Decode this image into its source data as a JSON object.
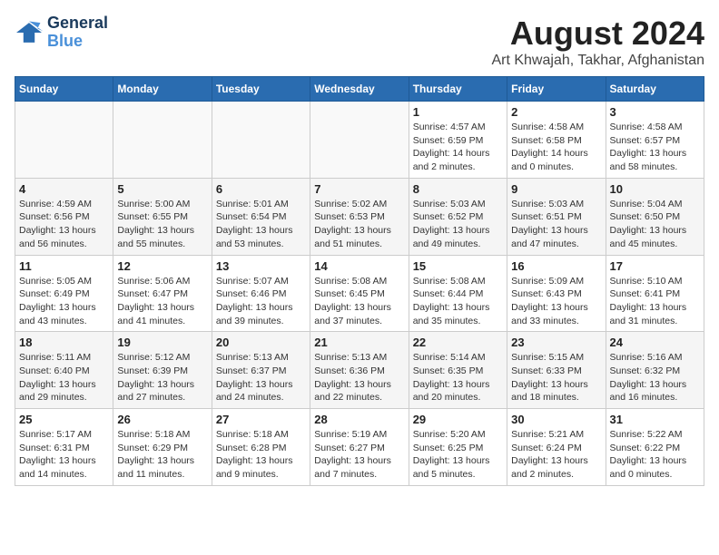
{
  "logo": {
    "line1": "General",
    "line2": "Blue"
  },
  "title": "August 2024",
  "subtitle": "Art Khwajah, Takhar, Afghanistan",
  "headers": [
    "Sunday",
    "Monday",
    "Tuesday",
    "Wednesday",
    "Thursday",
    "Friday",
    "Saturday"
  ],
  "weeks": [
    [
      {
        "day": "",
        "detail": ""
      },
      {
        "day": "",
        "detail": ""
      },
      {
        "day": "",
        "detail": ""
      },
      {
        "day": "",
        "detail": ""
      },
      {
        "day": "1",
        "detail": "Sunrise: 4:57 AM\nSunset: 6:59 PM\nDaylight: 14 hours\nand 2 minutes."
      },
      {
        "day": "2",
        "detail": "Sunrise: 4:58 AM\nSunset: 6:58 PM\nDaylight: 14 hours\nand 0 minutes."
      },
      {
        "day": "3",
        "detail": "Sunrise: 4:58 AM\nSunset: 6:57 PM\nDaylight: 13 hours\nand 58 minutes."
      }
    ],
    [
      {
        "day": "4",
        "detail": "Sunrise: 4:59 AM\nSunset: 6:56 PM\nDaylight: 13 hours\nand 56 minutes."
      },
      {
        "day": "5",
        "detail": "Sunrise: 5:00 AM\nSunset: 6:55 PM\nDaylight: 13 hours\nand 55 minutes."
      },
      {
        "day": "6",
        "detail": "Sunrise: 5:01 AM\nSunset: 6:54 PM\nDaylight: 13 hours\nand 53 minutes."
      },
      {
        "day": "7",
        "detail": "Sunrise: 5:02 AM\nSunset: 6:53 PM\nDaylight: 13 hours\nand 51 minutes."
      },
      {
        "day": "8",
        "detail": "Sunrise: 5:03 AM\nSunset: 6:52 PM\nDaylight: 13 hours\nand 49 minutes."
      },
      {
        "day": "9",
        "detail": "Sunrise: 5:03 AM\nSunset: 6:51 PM\nDaylight: 13 hours\nand 47 minutes."
      },
      {
        "day": "10",
        "detail": "Sunrise: 5:04 AM\nSunset: 6:50 PM\nDaylight: 13 hours\nand 45 minutes."
      }
    ],
    [
      {
        "day": "11",
        "detail": "Sunrise: 5:05 AM\nSunset: 6:49 PM\nDaylight: 13 hours\nand 43 minutes."
      },
      {
        "day": "12",
        "detail": "Sunrise: 5:06 AM\nSunset: 6:47 PM\nDaylight: 13 hours\nand 41 minutes."
      },
      {
        "day": "13",
        "detail": "Sunrise: 5:07 AM\nSunset: 6:46 PM\nDaylight: 13 hours\nand 39 minutes."
      },
      {
        "day": "14",
        "detail": "Sunrise: 5:08 AM\nSunset: 6:45 PM\nDaylight: 13 hours\nand 37 minutes."
      },
      {
        "day": "15",
        "detail": "Sunrise: 5:08 AM\nSunset: 6:44 PM\nDaylight: 13 hours\nand 35 minutes."
      },
      {
        "day": "16",
        "detail": "Sunrise: 5:09 AM\nSunset: 6:43 PM\nDaylight: 13 hours\nand 33 minutes."
      },
      {
        "day": "17",
        "detail": "Sunrise: 5:10 AM\nSunset: 6:41 PM\nDaylight: 13 hours\nand 31 minutes."
      }
    ],
    [
      {
        "day": "18",
        "detail": "Sunrise: 5:11 AM\nSunset: 6:40 PM\nDaylight: 13 hours\nand 29 minutes."
      },
      {
        "day": "19",
        "detail": "Sunrise: 5:12 AM\nSunset: 6:39 PM\nDaylight: 13 hours\nand 27 minutes."
      },
      {
        "day": "20",
        "detail": "Sunrise: 5:13 AM\nSunset: 6:37 PM\nDaylight: 13 hours\nand 24 minutes."
      },
      {
        "day": "21",
        "detail": "Sunrise: 5:13 AM\nSunset: 6:36 PM\nDaylight: 13 hours\nand 22 minutes."
      },
      {
        "day": "22",
        "detail": "Sunrise: 5:14 AM\nSunset: 6:35 PM\nDaylight: 13 hours\nand 20 minutes."
      },
      {
        "day": "23",
        "detail": "Sunrise: 5:15 AM\nSunset: 6:33 PM\nDaylight: 13 hours\nand 18 minutes."
      },
      {
        "day": "24",
        "detail": "Sunrise: 5:16 AM\nSunset: 6:32 PM\nDaylight: 13 hours\nand 16 minutes."
      }
    ],
    [
      {
        "day": "25",
        "detail": "Sunrise: 5:17 AM\nSunset: 6:31 PM\nDaylight: 13 hours\nand 14 minutes."
      },
      {
        "day": "26",
        "detail": "Sunrise: 5:18 AM\nSunset: 6:29 PM\nDaylight: 13 hours\nand 11 minutes."
      },
      {
        "day": "27",
        "detail": "Sunrise: 5:18 AM\nSunset: 6:28 PM\nDaylight: 13 hours\nand 9 minutes."
      },
      {
        "day": "28",
        "detail": "Sunrise: 5:19 AM\nSunset: 6:27 PM\nDaylight: 13 hours\nand 7 minutes."
      },
      {
        "day": "29",
        "detail": "Sunrise: 5:20 AM\nSunset: 6:25 PM\nDaylight: 13 hours\nand 5 minutes."
      },
      {
        "day": "30",
        "detail": "Sunrise: 5:21 AM\nSunset: 6:24 PM\nDaylight: 13 hours\nand 2 minutes."
      },
      {
        "day": "31",
        "detail": "Sunrise: 5:22 AM\nSunset: 6:22 PM\nDaylight: 13 hours\nand 0 minutes."
      }
    ]
  ]
}
